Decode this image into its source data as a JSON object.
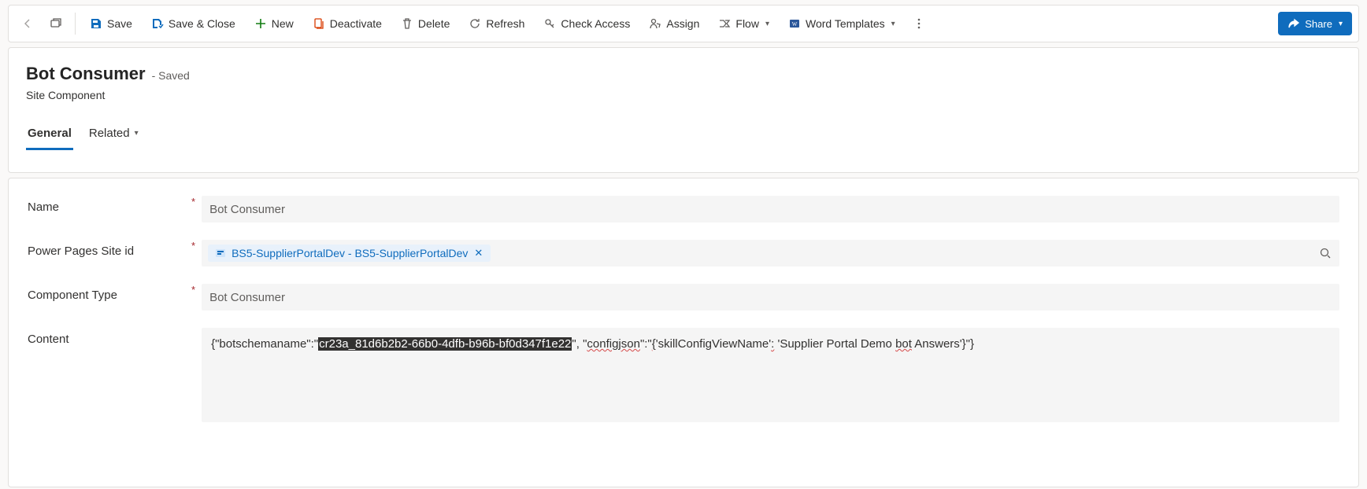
{
  "toolbar": {
    "save": "Save",
    "save_close": "Save & Close",
    "new": "New",
    "deactivate": "Deactivate",
    "delete": "Delete",
    "refresh": "Refresh",
    "check_access": "Check Access",
    "assign": "Assign",
    "flow": "Flow",
    "word_templates": "Word Templates",
    "share": "Share"
  },
  "header": {
    "title": "Bot Consumer",
    "status": "- Saved",
    "entity": "Site Component"
  },
  "tabs": {
    "general": "General",
    "related": "Related"
  },
  "form": {
    "labels": {
      "name": "Name",
      "site_id": "Power Pages Site id",
      "component_type": "Component Type",
      "content": "Content"
    },
    "fields": {
      "name": "Bot Consumer",
      "site_lookup": "BS5-SupplierPortalDev - BS5-SupplierPortalDev",
      "component_type": "Bot Consumer",
      "content": {
        "prefix": "{\"botschemaname\":\"",
        "selected": "cr23a_81d6b2b2-66b0-4dfb-b96b-bf0d347f1e22",
        "mid1": "\", \"",
        "configjson": "configjson",
        "mid2": "\":\"",
        "brace_open": "{",
        "skill_key": "'skillConfigViewName'",
        "colon": ":",
        "val_prefix": " 'Supplier Portal Demo ",
        "bot_word": "bot",
        "val_suffix": " Answers'}\"}"
      }
    }
  }
}
